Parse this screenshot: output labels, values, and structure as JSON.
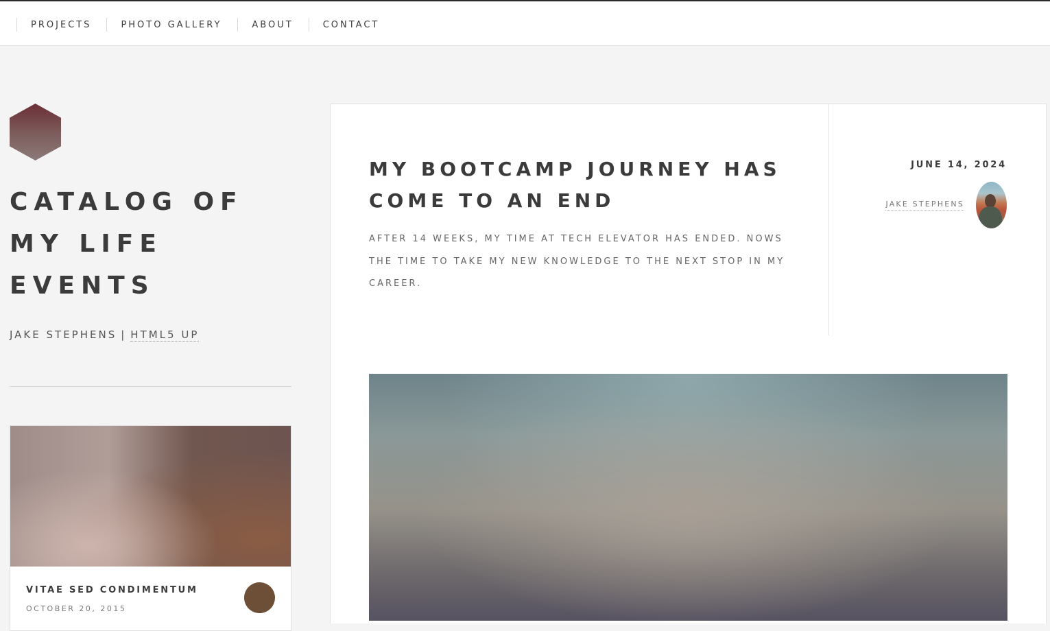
{
  "nav": {
    "items": [
      {
        "label": "PROJECTS"
      },
      {
        "label": "PHOTO GALLERY"
      },
      {
        "label": "ABOUT"
      },
      {
        "label": "CONTACT"
      }
    ]
  },
  "sidebar": {
    "title_lines": [
      "CATALOG OF",
      "MY LIFE",
      "EVENTS"
    ],
    "byline_author": "JAKE STEPHENS",
    "byline_separator": "|",
    "byline_link": "HTML5 UP",
    "mini_post": {
      "title": "VITAE SED CONDIMENTUM",
      "date": "OCTOBER 20, 2015"
    }
  },
  "post": {
    "title_lines": [
      "MY BOOTCAMP JOURNEY HAS",
      "COME TO AN END"
    ],
    "excerpt": "AFTER 14 WEEKS, MY TIME AT TECH ELEVATOR HAS ENDED. NOWS THE TIME TO TAKE MY NEW KNOWLEDGE TO THE NEXT STOP IN MY CAREER.",
    "date": "JUNE 14, 2024",
    "author": "JAKE STEPHENS"
  },
  "colors": {
    "accent_text": "#3c3b3b",
    "page_background": "#f4f4f4",
    "card_background": "#ffffff"
  }
}
